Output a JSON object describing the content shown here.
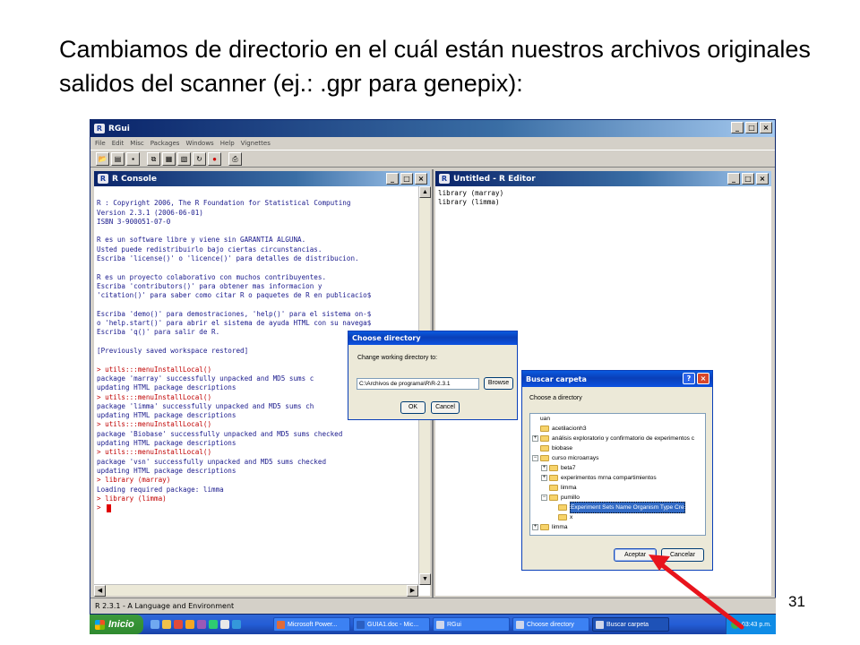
{
  "slide": {
    "title": "Cambiamos de directorio en el cuál están nuestros archivos originales salidos del scanner (ej.: .gpr para genepix):",
    "page_number": "31"
  },
  "rgui": {
    "title": "RGui",
    "menu": [
      "File",
      "Edit",
      "Misc",
      "Packages",
      "Windows",
      "Help",
      "Vignettes"
    ],
    "status": "R 2.3.1 - A Language and Environment"
  },
  "console": {
    "title": "R Console",
    "lines": [
      {
        "text": "",
        "color": "blue"
      },
      {
        "text": "R : Copyright 2006, The R Foundation for Statistical Computing",
        "color": "blue"
      },
      {
        "text": "Version 2.3.1 (2006-06-01)",
        "color": "blue"
      },
      {
        "text": "ISBN 3-900051-07-0",
        "color": "blue"
      },
      {
        "text": "",
        "color": "blue"
      },
      {
        "text": "R es un software libre y viene sin GARANTIA ALGUNA.",
        "color": "blue"
      },
      {
        "text": "Usted puede redistribuirlo bajo ciertas circunstancias.",
        "color": "blue"
      },
      {
        "text": "Escriba 'license()' o 'licence()' para detalles de distribucion.",
        "color": "blue"
      },
      {
        "text": "",
        "color": "blue"
      },
      {
        "text": "R es un proyecto colaborativo con muchos contribuyentes.",
        "color": "blue"
      },
      {
        "text": "Escriba 'contributors()' para obtener mas informacion y",
        "color": "blue"
      },
      {
        "text": "'citation()' para saber como citar R o paquetes de R en publicacio$",
        "color": "blue"
      },
      {
        "text": "",
        "color": "blue"
      },
      {
        "text": "Escriba 'demo()' para demostraciones, 'help()' para el sistema on-$",
        "color": "blue"
      },
      {
        "text": "o 'help.start()' para abrir el sistema de ayuda HTML con su navega$",
        "color": "blue"
      },
      {
        "text": "Escriba 'q()' para salir de R.",
        "color": "blue"
      },
      {
        "text": "",
        "color": "blue"
      },
      {
        "text": "[Previously saved workspace restored]",
        "color": "blue"
      },
      {
        "text": "",
        "color": "blue"
      },
      {
        "text": "> utils:::menuInstallLocal()",
        "color": "red"
      },
      {
        "text": "package 'marray' successfully unpacked and MD5 sums c",
        "color": "blue"
      },
      {
        "text": "updating HTML package descriptions",
        "color": "blue"
      },
      {
        "text": "> utils:::menuInstallLocal()",
        "color": "red"
      },
      {
        "text": "package 'limma' successfully unpacked and MD5 sums ch",
        "color": "blue"
      },
      {
        "text": "updating HTML package descriptions",
        "color": "blue"
      },
      {
        "text": "> utils:::menuInstallLocal()",
        "color": "red"
      },
      {
        "text": "package 'Biobase' successfully unpacked and MD5 sums checked",
        "color": "blue"
      },
      {
        "text": "updating HTML package descriptions",
        "color": "blue"
      },
      {
        "text": "> utils:::menuInstallLocal()",
        "color": "red"
      },
      {
        "text": "package 'vsn' successfully unpacked and MD5 sums checked",
        "color": "blue"
      },
      {
        "text": "updating HTML package descriptions",
        "color": "blue"
      },
      {
        "text": "> library (marray)",
        "color": "red"
      },
      {
        "text": "Loading required package: limma",
        "color": "blue"
      },
      {
        "text": "> library (limma)",
        "color": "red"
      },
      {
        "text": "> ",
        "color": "red"
      }
    ]
  },
  "editor": {
    "title": "Untitled - R Editor",
    "lines": [
      "library (marray)",
      "library (limma)"
    ]
  },
  "choose_dir": {
    "title": "Choose directory",
    "label": "Change working directory to:",
    "path": "C:\\Archivos de programa\\R\\R-2.3.1",
    "browse": "Browse",
    "ok": "OK",
    "cancel": "Cancel"
  },
  "buscar": {
    "title": "Buscar carpeta",
    "label": "Choose a directory",
    "tree": [
      {
        "label": "uan",
        "indent": 0,
        "exp": "",
        "folder": false,
        "selected": false
      },
      {
        "label": "acetilacionh3",
        "indent": 0,
        "exp": "",
        "folder": true,
        "selected": false
      },
      {
        "label": "análisis exploratorio y confirmatorio de experimentos c",
        "indent": 0,
        "exp": "+",
        "folder": true,
        "selected": false
      },
      {
        "label": "biobase",
        "indent": 0,
        "exp": "",
        "folder": true,
        "selected": false
      },
      {
        "label": "curso microarrays",
        "indent": 0,
        "exp": "−",
        "folder": true,
        "selected": false
      },
      {
        "label": "beta7",
        "indent": 1,
        "exp": "+",
        "folder": true,
        "selected": false
      },
      {
        "label": "experimentos mrna compartimientos",
        "indent": 1,
        "exp": "+",
        "folder": true,
        "selected": false
      },
      {
        "label": "limma",
        "indent": 1,
        "exp": "",
        "folder": true,
        "selected": false
      },
      {
        "label": "pumillo",
        "indent": 1,
        "exp": "−",
        "folder": true,
        "selected": false
      },
      {
        "label": "Experiment Sets Name Organism Type Cre",
        "indent": 2,
        "exp": "",
        "folder": true,
        "selected": true
      },
      {
        "label": "x",
        "indent": 2,
        "exp": "",
        "folder": true,
        "selected": false
      },
      {
        "label": "limma",
        "indent": 0,
        "exp": "+",
        "folder": true,
        "selected": false
      }
    ],
    "accept": "Aceptar",
    "cancel": "Cancelar"
  },
  "taskbar": {
    "start": "Inicio",
    "tasks": [
      "Microsoft Power...",
      "GUIA1.doc - Mic...",
      "RGui",
      "Choose directory",
      "Buscar carpeta"
    ],
    "clock": "03:43 p.m."
  },
  "colors": {
    "arrow": "#e8141c",
    "console_text": "#1a1a8c",
    "console_prompt": "#c00000",
    "selection": "#316ac5"
  }
}
